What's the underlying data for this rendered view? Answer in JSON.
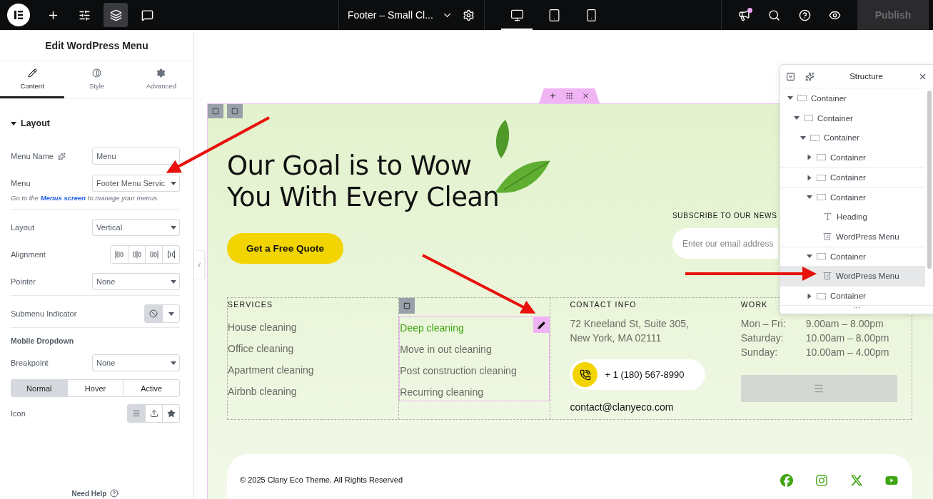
{
  "topbar": {
    "tools": [
      {
        "kind": "add",
        "selected": false
      },
      {
        "kind": "settings",
        "selected": false
      },
      {
        "kind": "structure",
        "selected": true
      },
      {
        "kind": "notes",
        "selected": false
      }
    ],
    "document_title": "Footer – Small Cl...",
    "devices": [
      {
        "kind": "desktop",
        "selected": true
      },
      {
        "kind": "tablet",
        "selected": false
      },
      {
        "kind": "mobile",
        "selected": false
      }
    ],
    "has_notification": true,
    "publish": {
      "label": "Publish",
      "disabled": true
    }
  },
  "panel": {
    "title": "Edit WordPress Menu",
    "tabs": [
      {
        "label": "Content",
        "kind": "content",
        "selected": true
      },
      {
        "label": "Style",
        "kind": "style",
        "selected": false
      },
      {
        "label": "Advanced",
        "kind": "advanced",
        "selected": false
      }
    ],
    "section": {
      "title": "Layout",
      "expanded": true
    },
    "controls": [
      {
        "kind": "input",
        "label": "Menu Name",
        "ai": true,
        "value": "Menu"
      },
      {
        "kind": "select",
        "label": "Menu",
        "value": "Footer Menu Servic"
      },
      {
        "kind": "hint",
        "before": "Go to the",
        "link": "Menus screen",
        "after": "to manage your menus."
      },
      {
        "kind": "divider"
      },
      {
        "kind": "select",
        "label": "Layout",
        "value": "Vertical"
      },
      {
        "kind": "choices",
        "label": "Alignment",
        "options": [
          {
            "kind": "start",
            "selected": false
          },
          {
            "kind": "center",
            "selected": false
          },
          {
            "kind": "end",
            "selected": false
          },
          {
            "kind": "stretch",
            "selected": false
          }
        ]
      },
      {
        "kind": "select",
        "label": "Pointer",
        "value": "None"
      },
      {
        "kind": "divider"
      },
      {
        "kind": "indicator",
        "label": "Submenu Indicator"
      },
      {
        "kind": "divider"
      },
      {
        "kind": "heading",
        "text": "Mobile Dropdown"
      },
      {
        "kind": "select",
        "label": "Breakpoint",
        "value": "None"
      },
      {
        "kind": "states",
        "options": [
          {
            "label": "Normal",
            "selected": true
          },
          {
            "label": "Hover",
            "selected": false
          },
          {
            "label": "Active",
            "selected": false
          }
        ]
      },
      {
        "kind": "choices",
        "label": "Icon",
        "options": [
          {
            "kind": "bars",
            "selected": true
          },
          {
            "kind": "upload",
            "selected": false
          },
          {
            "kind": "star",
            "selected": false
          }
        ]
      }
    ],
    "help": "Need Help"
  },
  "canvas": {
    "hero": {
      "heading_lines": [
        "Our Goal is to Wow",
        "You With Every Clean"
      ],
      "button": "Get a Free Quote"
    },
    "subscribe": {
      "label": "SUBSCRIBE TO OUR NEWS",
      "placeholder": "Enter our email address"
    },
    "services": {
      "title": "SERVICES",
      "items": [
        "House cleaning",
        "Office cleaning",
        "Apartment cleaning",
        "Airbnb cleaning"
      ]
    },
    "menu": {
      "items": [
        {
          "label": "Deep cleaning",
          "active": true
        },
        {
          "label": "Move in out cleaning",
          "active": false
        },
        {
          "label": "Post construction cleaning",
          "active": false
        },
        {
          "label": "Recurring cleaning",
          "active": false
        }
      ]
    },
    "contact": {
      "title": "CONTACT INFO",
      "address_lines": [
        "72 Kneeland St, Suite 305,",
        "New York, MA 02111"
      ],
      "phone": "+ 1 (180) 567-8990",
      "email": "contact@clanyeco.com"
    },
    "hours": {
      "title": "WORK",
      "rows": [
        {
          "day": "Mon – Fri:",
          "time": "9.00am – 8.00pm"
        },
        {
          "day": "Saturday:",
          "time": "10.00am – 8.00pm"
        },
        {
          "day": "Sunday:",
          "time": "10.00am – 4.00pm"
        }
      ]
    },
    "footer": {
      "copyright": "© 2025 Clany Eco Theme. All Rights Reserved",
      "socials": [
        {
          "kind": "facebook"
        },
        {
          "kind": "instagram"
        },
        {
          "kind": "x"
        },
        {
          "kind": "youtube"
        }
      ]
    }
  },
  "structure": {
    "title": "Structure",
    "more": "···",
    "tree": [
      {
        "label": "Container",
        "kind": "container",
        "expanded": true,
        "selected": false,
        "children": [
          {
            "label": "Container",
            "kind": "container",
            "expanded": true,
            "selected": false,
            "children": [
              {
                "label": "Container",
                "kind": "container",
                "expanded": true,
                "selected": false,
                "children": [
                  {
                    "label": "Container",
                    "kind": "container",
                    "expanded": false,
                    "selected": false
                  },
                  {
                    "label": "Container",
                    "kind": "container",
                    "expanded": false,
                    "selected": false
                  },
                  {
                    "label": "Container",
                    "kind": "container",
                    "expanded": true,
                    "selected": false,
                    "children": [
                      {
                        "label": "Heading",
                        "kind": "heading",
                        "selected": false
                      },
                      {
                        "label": "WordPress Menu",
                        "kind": "menu",
                        "selected": false
                      }
                    ]
                  },
                  {
                    "label": "Container",
                    "kind": "container",
                    "expanded": true,
                    "selected": false,
                    "children": [
                      {
                        "label": "WordPress Menu",
                        "kind": "menu",
                        "selected": true
                      }
                    ]
                  },
                  {
                    "label": "Container",
                    "kind": "container",
                    "expanded": false,
                    "selected": false
                  }
                ]
              }
            ]
          }
        ]
      }
    ]
  }
}
